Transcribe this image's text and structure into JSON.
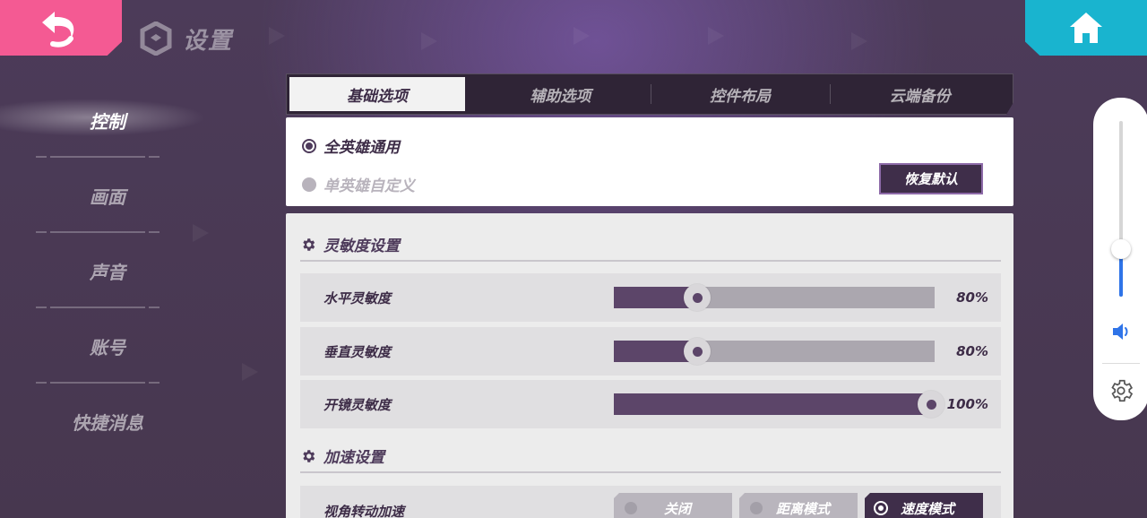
{
  "header": {
    "title": "设置",
    "back_icon": "back-arrow-icon",
    "home_icon": "home-icon",
    "colors": {
      "back": "#f45a93",
      "home": "#19b4cf"
    }
  },
  "sidebar": {
    "items": [
      {
        "label": "控制",
        "active": true
      },
      {
        "label": "画面",
        "active": false
      },
      {
        "label": "声音",
        "active": false
      },
      {
        "label": "账号",
        "active": false
      },
      {
        "label": "快捷消息",
        "active": false
      }
    ]
  },
  "tabs": [
    {
      "label": "基础选项",
      "active": true
    },
    {
      "label": "辅助选项",
      "active": false
    },
    {
      "label": "控件布局",
      "active": false
    },
    {
      "label": "云端备份",
      "active": false
    }
  ],
  "mode": {
    "option_all": "全英雄通用",
    "option_single": "单英雄自定义",
    "selected": "全英雄通用",
    "reset_button": "恢复默认"
  },
  "sensitivity": {
    "section_title": "灵敏度设置",
    "rows": [
      {
        "label": "水平灵敏度",
        "value": "80%",
        "level": 0.26
      },
      {
        "label": "垂直灵敏度",
        "value": "80%",
        "level": 0.26
      },
      {
        "label": "开镜灵敏度",
        "value": "100%",
        "level": 0.99
      }
    ]
  },
  "acceleration": {
    "section_title": "加速设置",
    "row_label": "视角转动加速",
    "options": [
      {
        "label": "关闭",
        "active": false
      },
      {
        "label": "距离模式",
        "active": false
      },
      {
        "label": "速度模式",
        "active": true
      }
    ]
  },
  "float_panel": {
    "volume_level": 0.27,
    "speaker_icon": "speaker-icon",
    "settings_icon": "gear-icon",
    "accent": "#2f74e8"
  }
}
